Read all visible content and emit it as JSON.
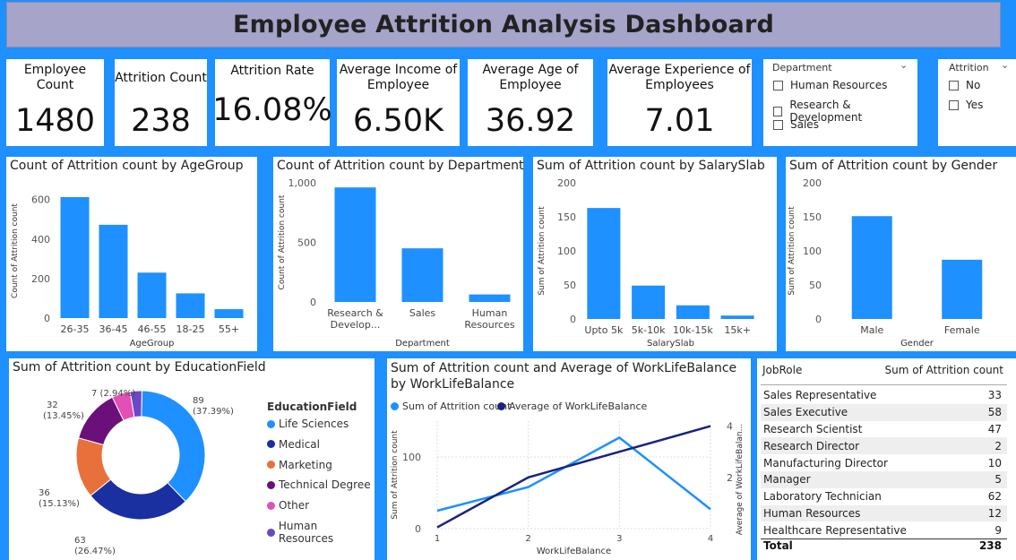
{
  "title": "Employee Attrition Analysis Dashboard",
  "kpis": [
    {
      "label": "Employee Count",
      "value": "1480"
    },
    {
      "label": "Attrition Count",
      "value": "238"
    },
    {
      "label": "Attrition Rate",
      "value": "16.08%"
    },
    {
      "label": "Average Income of Employee",
      "value": "6.50K"
    },
    {
      "label": "Average Age of Employee",
      "value": "36.92"
    },
    {
      "label": "Average Experience of Employees",
      "value": "7.01"
    }
  ],
  "slicers": {
    "department": {
      "title": "Department",
      "options": [
        "Human Resources",
        "Research & Development",
        "Sales"
      ]
    },
    "attrition": {
      "title": "Attrition",
      "options": [
        "No",
        "Yes"
      ]
    }
  },
  "chart_data": [
    {
      "id": "age",
      "type": "bar",
      "title": "Count of Attrition count by AgeGroup",
      "xlabel": "AgeGroup",
      "ylabel": "Count of Attrition count",
      "categories": [
        "26-35",
        "36-45",
        "46-55",
        "18-25",
        "55+"
      ],
      "values": [
        612,
        472,
        230,
        125,
        45
      ],
      "ylim": [
        0,
        680
      ],
      "yticks": [
        0,
        200,
        400,
        600
      ],
      "ytick_labels": [
        "0",
        "200",
        "400",
        "600"
      ],
      "color": "#1e90ff"
    },
    {
      "id": "dept",
      "type": "bar",
      "title": "Count of Attrition count by Department",
      "xlabel": "Department",
      "ylabel": "Count of Attrition count",
      "categories": [
        "Research & Develop...",
        "Sales",
        "Human Resources"
      ],
      "values": [
        961,
        450,
        63
      ],
      "ylim": [
        0,
        1000
      ],
      "yticks": [
        0,
        500,
        1000
      ],
      "ytick_labels": [
        "0",
        "500",
        "1,000"
      ],
      "color": "#1e90ff"
    },
    {
      "id": "salary",
      "type": "bar",
      "title": "Sum of Attrition count by SalarySlab",
      "xlabel": "SalarySlab",
      "ylabel": "Sum of Attrition count",
      "categories": [
        "Upto 5k",
        "5k-10k",
        "10k-15k",
        "15k+"
      ],
      "values": [
        163,
        49,
        20,
        5
      ],
      "ylim": [
        0,
        200
      ],
      "yticks": [
        0,
        50,
        100,
        150,
        200
      ],
      "ytick_labels": [
        "0",
        "50",
        "100",
        "150",
        "200"
      ],
      "color": "#1e90ff"
    },
    {
      "id": "gender",
      "type": "bar",
      "title": "Sum of Attrition count by Gender",
      "xlabel": "Gender",
      "ylabel": "Sum of Attrition count",
      "categories": [
        "Male",
        "Female"
      ],
      "values": [
        151,
        87
      ],
      "ylim": [
        0,
        200
      ],
      "yticks": [
        0,
        50,
        100,
        150,
        200
      ],
      "ytick_labels": [
        "0",
        "50",
        "100",
        "150",
        "200"
      ],
      "color": "#1e90ff"
    },
    {
      "id": "edu",
      "type": "pie",
      "title": "Sum of Attrition count by EducationField",
      "legend_title": "EducationField",
      "categories": [
        "Life Sciences",
        "Medical",
        "Marketing",
        "Technical Degree",
        "Other",
        "Human Resources"
      ],
      "values": [
        89,
        63,
        36,
        32,
        11,
        7
      ],
      "data_labels": [
        "89 (37.39%)",
        "63 (26.47%)",
        "36 (15.13%)",
        "32 (13.45%)",
        "",
        "7 (2.94%)"
      ],
      "colors": [
        "#1e90ff",
        "#1a2fa0",
        "#e8703a",
        "#6b0f7a",
        "#e24fb5",
        "#6b48c8"
      ],
      "legend_position": "right"
    },
    {
      "id": "wlb",
      "type": "line",
      "title": "Sum of Attrition count and Average of WorkLifeBalance by WorkLifeBalance",
      "xlabel": "WorkLifeBalance",
      "ylabel": "Sum of Attrition count",
      "y2label": "Average of WorkLifeBalan...",
      "x": [
        1,
        2,
        3,
        4
      ],
      "series": [
        {
          "name": "Sum of Attrition count",
          "values": [
            25,
            58,
            127,
            27
          ],
          "axis": "left",
          "color": "#1e90ff"
        },
        {
          "name": "Average of WorkLifeBalance",
          "values": [
            1,
            2,
            3,
            4
          ],
          "axis": "right",
          "color": "#1a237e"
        }
      ],
      "ylim": [
        0,
        150
      ],
      "yticks": [
        0,
        100
      ],
      "y2lim": [
        1,
        4
      ],
      "y2ticks": [
        2,
        4
      ],
      "legend_position": "top-left",
      "grid": true
    }
  ],
  "jobrole_table": {
    "headers": [
      "JobRole",
      "Sum of Attrition count"
    ],
    "rows": [
      [
        "Sales Representative",
        "33"
      ],
      [
        "Sales Executive",
        "58"
      ],
      [
        "Research Scientist",
        "47"
      ],
      [
        "Research Director",
        "2"
      ],
      [
        "Manufacturing Director",
        "10"
      ],
      [
        "Manager",
        "5"
      ],
      [
        "Laboratory Technician",
        "62"
      ],
      [
        "Human Resources",
        "12"
      ],
      [
        "Healthcare Representative",
        "9"
      ]
    ],
    "total_label": "Total",
    "total_value": "238"
  }
}
